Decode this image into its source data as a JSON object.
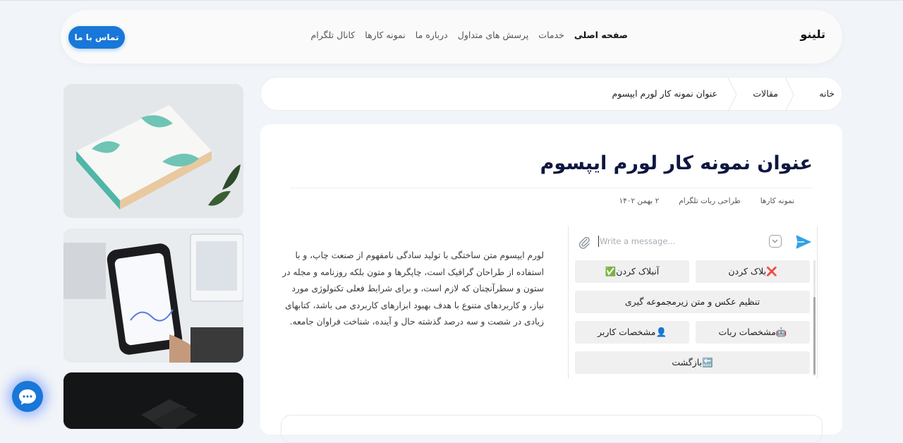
{
  "header": {
    "logo": "تلینو",
    "nav": [
      "صفحه اصلی",
      "خدمات",
      "پرسش های متداول",
      "درباره ما",
      "نمونه کارها",
      "کانال تلگرام"
    ],
    "contact_label": "تماس با ما"
  },
  "breadcrumb": [
    "خانه",
    "مقالات",
    "عنوان نمونه کار لورم ایپسوم"
  ],
  "article": {
    "title": "عنوان نمونه کار لورم ایپسوم",
    "meta": [
      "نمونه کارها",
      "طراحی ربات تلگرام",
      "۲ بهمن ۱۴۰۲"
    ],
    "body": "لورم ایپسوم متن ساختگی با تولید سادگی نامفهوم از صنعت چاپ، و با استفاده از طراحان گرافیک است، چاپگرها و متون بلکه روزنامه و مجله در ستون و سطرآنچنان که لازم است، و برای شرایط فعلی تکنولوژی مورد نیاز، و کاربردهای متنوع با هدف بهبود ابزارهای کاربردی می باشد، کتابهای زیادی در شصت و سه درصد گذشته حال و آینده، شناخت فراوان جامعه."
  },
  "telegram": {
    "placeholder": "Write a message...",
    "buttons": {
      "block": "❌بلاک کردن",
      "unblock": "آنبلاک کردن✅",
      "photo_settings": "تنظیم عکس و متن زیرمجموعه گیری",
      "bot_info": "🤖مشخصات ربات",
      "user_info": "👤مشخصات کاربر",
      "back": "🔙بازگشت"
    }
  },
  "colors": {
    "accent": "#1877d8",
    "title": "#0e1740",
    "background": "#f1f4f8"
  },
  "icons": [
    "paperclip-icon",
    "keyboard-icon",
    "send-icon",
    "chat-icon"
  ]
}
